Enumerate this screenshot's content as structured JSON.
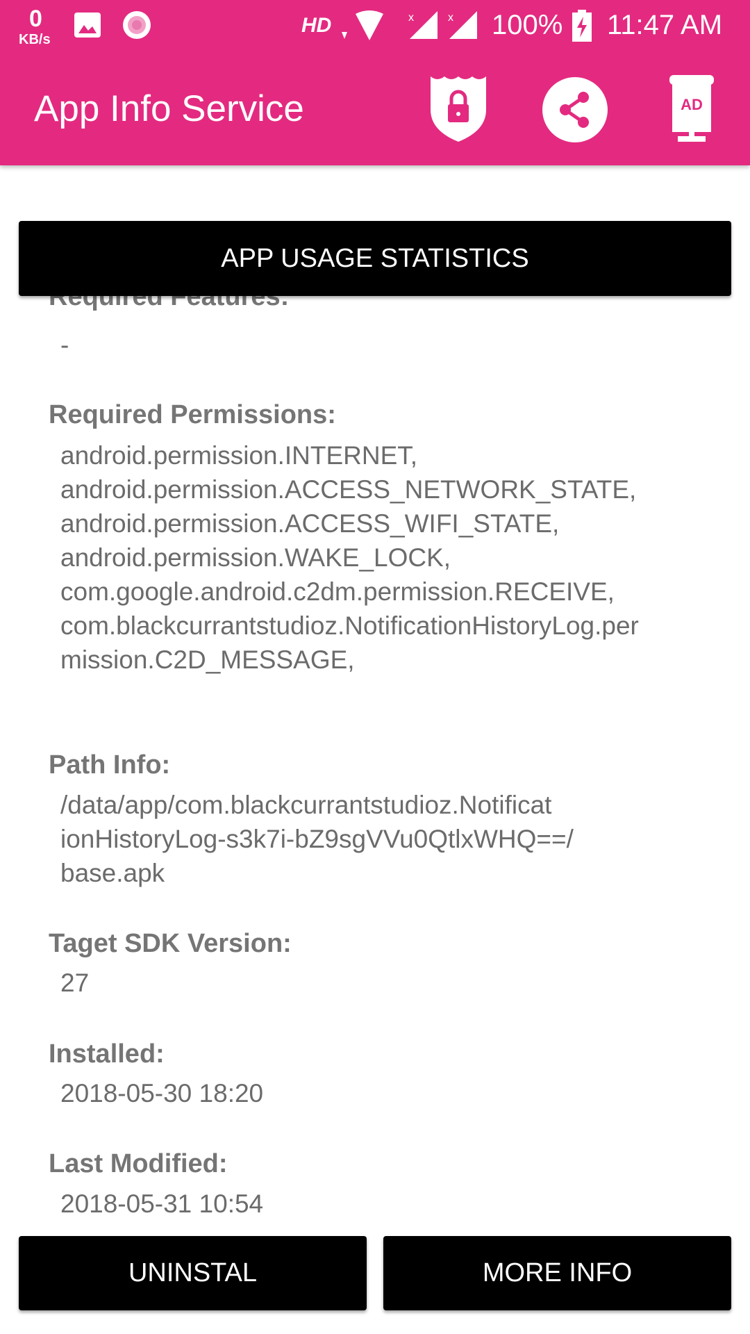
{
  "status_bar": {
    "net_speed": "0",
    "net_unit": "KB/s",
    "hd": "HD",
    "battery": "100%",
    "time": "11:47 AM",
    "icons": [
      "gallery-icon",
      "record-icon",
      "wifi-icon",
      "signal-icon",
      "signal-icon",
      "battery-charging-icon"
    ]
  },
  "app_bar": {
    "title": "App Info Service",
    "actions": [
      "shield-lock-icon",
      "share-icon",
      "ad-icon"
    ],
    "color": "#E32A80"
  },
  "usage_button": "APP USAGE STATISTICS",
  "sections": [
    {
      "label": "Required Features:",
      "value": "-"
    },
    {
      "label": "Required Permissions:",
      "value": "android.permission.INTERNET,\nandroid.permission.ACCESS_NETWORK_STATE,\nandroid.permission.ACCESS_WIFI_STATE,\nandroid.permission.WAKE_LOCK,\ncom.google.android.c2dm.permission.RECEIVE,\ncom.blackcurrantstudioz.NotificationHistoryLog.per\nmission.C2D_MESSAGE,"
    },
    {
      "label": "Path Info:",
      "value": "/data/app/com.blackcurrantstudioz.Notificat\nionHistoryLog-s3k7i-bZ9sgVVu0QtlxWHQ==/\nbase.apk"
    },
    {
      "label": "Taget SDK Version:",
      "value": "27"
    },
    {
      "label": "Installed:",
      "value": "2018-05-30 18:20"
    },
    {
      "label": "Last Modified:",
      "value": "2018-05-31 10:54"
    }
  ],
  "bottom_buttons": {
    "uninstall": "UNINSTAL",
    "more_info": "MORE INFO"
  }
}
